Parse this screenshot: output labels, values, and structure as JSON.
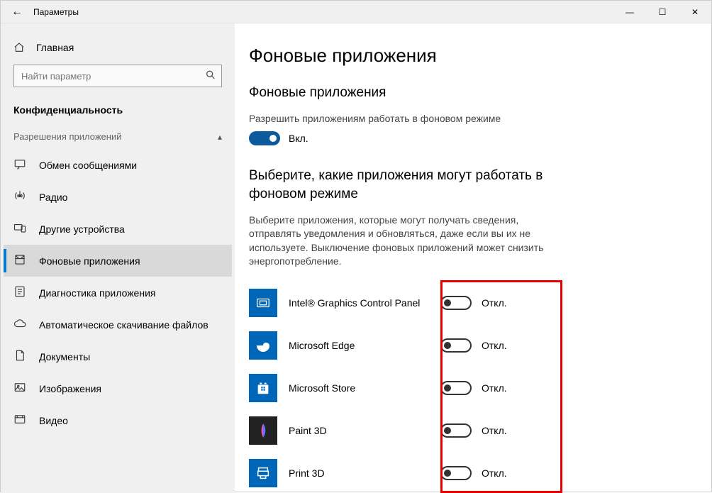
{
  "titlebar": {
    "title": "Параметры"
  },
  "sidebar": {
    "home": "Главная",
    "search_placeholder": "Найти параметр",
    "page_label": "Конфиденциальность",
    "group": "Разрешения приложений",
    "items": [
      {
        "label": "Обмен сообщениями",
        "icon": "messaging"
      },
      {
        "label": "Радио",
        "icon": "radio"
      },
      {
        "label": "Другие устройства",
        "icon": "devices"
      },
      {
        "label": "Фоновые приложения",
        "icon": "background",
        "selected": true
      },
      {
        "label": "Диагностика приложения",
        "icon": "diag"
      },
      {
        "label": "Автоматическое скачивание файлов",
        "icon": "cloud"
      },
      {
        "label": "Документы",
        "icon": "doc"
      },
      {
        "label": "Изображения",
        "icon": "image"
      },
      {
        "label": "Видео",
        "icon": "video"
      }
    ]
  },
  "content": {
    "heading": "Фоновые приложения",
    "section1_title": "Фоновые приложения",
    "section1_desc": "Разрешить приложениям работать в фоновом режиме",
    "master_toggle_state": "Вкл.",
    "section2_title": "Выберите, какие приложения могут работать в фоновом режиме",
    "section2_desc": "Выберите приложения, которые могут получать сведения, отправлять уведомления и обновляться, даже если вы их не используете. Выключение фоновых приложений может снизить энергопотребление.",
    "apps": [
      {
        "name": "Intel® Graphics Control Panel",
        "state": "Откл.",
        "icon": "intel"
      },
      {
        "name": "Microsoft Edge",
        "state": "Откл.",
        "icon": "edge"
      },
      {
        "name": "Microsoft Store",
        "state": "Откл.",
        "icon": "store"
      },
      {
        "name": "Paint 3D",
        "state": "Откл.",
        "icon": "paint3d"
      },
      {
        "name": "Print 3D",
        "state": "Откл.",
        "icon": "print3d"
      }
    ]
  }
}
